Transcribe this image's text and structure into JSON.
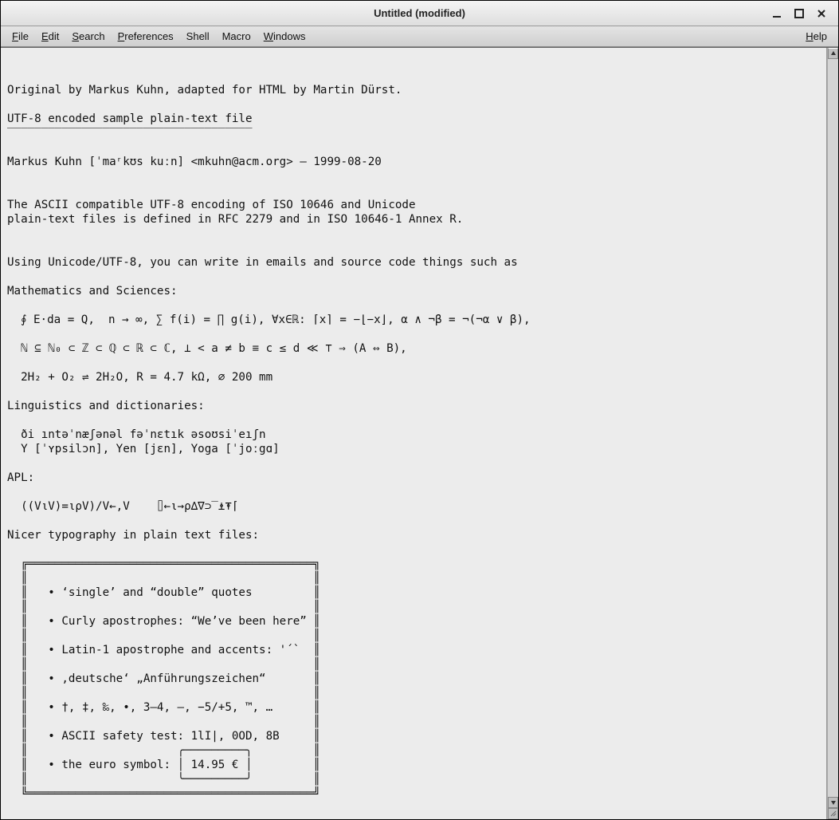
{
  "window": {
    "title": "Untitled (modified)"
  },
  "menu": {
    "file": "File",
    "edit": "Edit",
    "search": "Search",
    "preferences": "Preferences",
    "shell": "Shell",
    "macro": "Macro",
    "windows": "Windows",
    "help": "Help"
  },
  "content": "\n\nOriginal by Markus Kuhn, adapted for HTML by Martin Dürst.\n\nUTF-8 encoded sample plain-text file\n‾‾‾‾‾‾‾‾‾‾‾‾‾‾‾‾‾‾‾‾‾‾‾‾‾‾‾‾‾‾‾‾‾‾‾‾\n\nMarkus Kuhn [ˈmaʳkʊs kuːn] <mkuhn@acm.org> — 1999-08-20\n\n\nThe ASCII compatible UTF-8 encoding of ISO 10646 and Unicode\nplain-text files is defined in RFC 2279 and in ISO 10646-1 Annex R.\n\n\nUsing Unicode/UTF-8, you can write in emails and source code things such as\n\nMathematics and Sciences:\n\n  ∮ E⋅da = Q,  n → ∞, ∑ f(i) = ∏ g(i), ∀x∈ℝ: ⌈x⌉ = −⌊−x⌋, α ∧ ¬β = ¬(¬α ∨ β),\n\n  ℕ ⊆ ℕ₀ ⊂ ℤ ⊂ ℚ ⊂ ℝ ⊂ ℂ, ⊥ < a ≠ b ≡ c ≤ d ≪ ⊤ ⇒ (A ⇔ B),\n\n  2H₂ + O₂ ⇌ 2H₂O, R = 4.7 kΩ, ⌀ 200 mm\n\nLinguistics and dictionaries:\n\n  ði ıntəˈnæʃənəl fəˈnɛtık əsoʊsiˈeıʃn\n  Y [ˈʏpsilɔn], Yen [jɛn], Yoga [ˈjoːgɑ]\n\nAPL:\n\n  ((V⍳V)=⍳ρV)/V←,V    ⌷←⍳→ρ∆∇⊃‾⍎⍕⌈\n\nNicer typography in plain text files:\n\n  ╔══════════════════════════════════════════╗\n  ║                                          ║\n  ║   • ‘single’ and “double” quotes         ║\n  ║                                          ║\n  ║   • Curly apostrophes: “We’ve been here” ║\n  ║                                          ║\n  ║   • Latin-1 apostrophe and accents: '´`  ║\n  ║                                          ║\n  ║   • ‚deutsche‘ „Anführungszeichen“       ║\n  ║                                          ║\n  ║   • †, ‡, ‰, •, 3–4, —, −5/+5, ™, …      ║\n  ║                                          ║\n  ║   • ASCII safety test: 1lI|, 0OD, 8B     ║\n  ║                      ╭─────────╮         ║\n  ║   • the euro symbol: │ 14.95 € │         ║\n  ║                      ╰─────────╯         ║\n  ╚══════════════════════════════════════════╝"
}
